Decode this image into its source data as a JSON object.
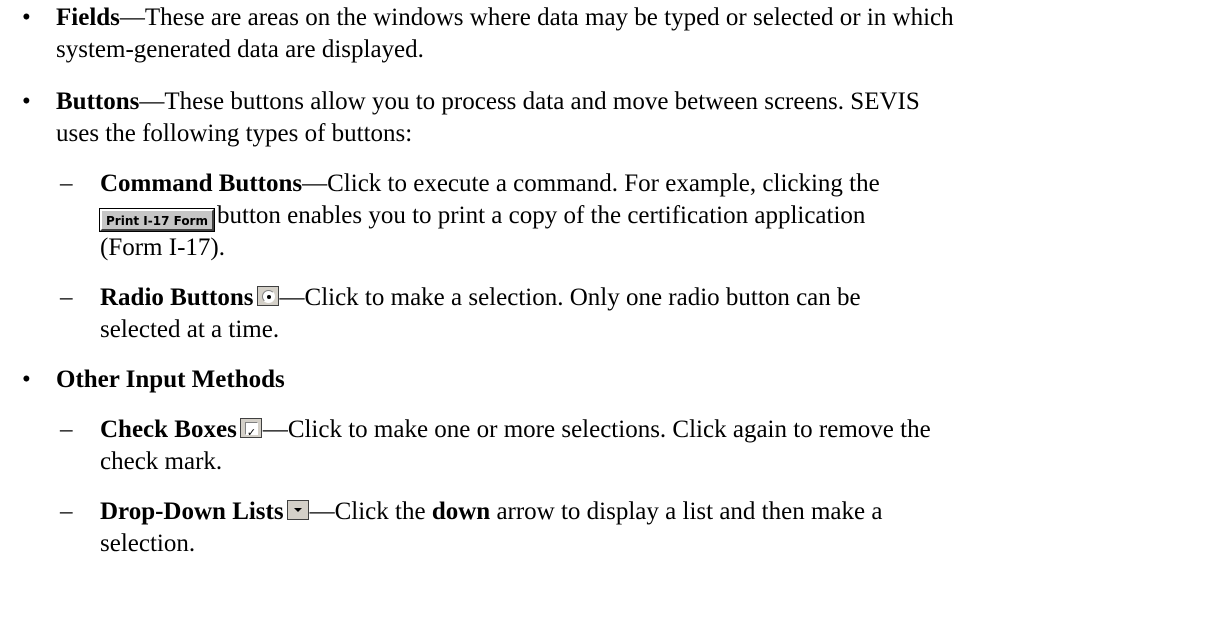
{
  "bullet_char": "•",
  "dash_char": "–",
  "em_dash": "—",
  "fields": {
    "term": "Fields",
    "line1": "These are areas on the windows where data may be typed or selected or in which",
    "line2": "system-generated data are displayed."
  },
  "buttons": {
    "term": "Buttons",
    "line1": "These buttons allow you to process data and move between screens.  SEVIS",
    "line2": "uses the following types of buttons:"
  },
  "command_buttons": {
    "term": "Command Buttons",
    "line1": "Click to execute a command.  For example, clicking the",
    "button_label": "Print I-17 Form",
    "line2": "button enables you to print a copy of the certification application",
    "line3": "(Form I-17)."
  },
  "radio_buttons": {
    "term": "Radio Buttons",
    "line1": "Click to make a selection.  Only one radio button can be",
    "line2": "selected at a time."
  },
  "other_input": {
    "term": "Other Input Methods"
  },
  "check_boxes": {
    "term": "Check Boxes",
    "line1": "Click to make one or more selections.  Click again to remove the",
    "line2": "check mark."
  },
  "drop_down": {
    "term": "Drop-Down Lists",
    "line1_a": "Click the ",
    "line1_bold": "down",
    "line1_b": " arrow to display a list and then make a",
    "line2": "selection."
  },
  "icons": {
    "radio": "radio-button-icon",
    "check": "checkbox-icon",
    "dropdown": "dropdown-arrow-icon"
  }
}
